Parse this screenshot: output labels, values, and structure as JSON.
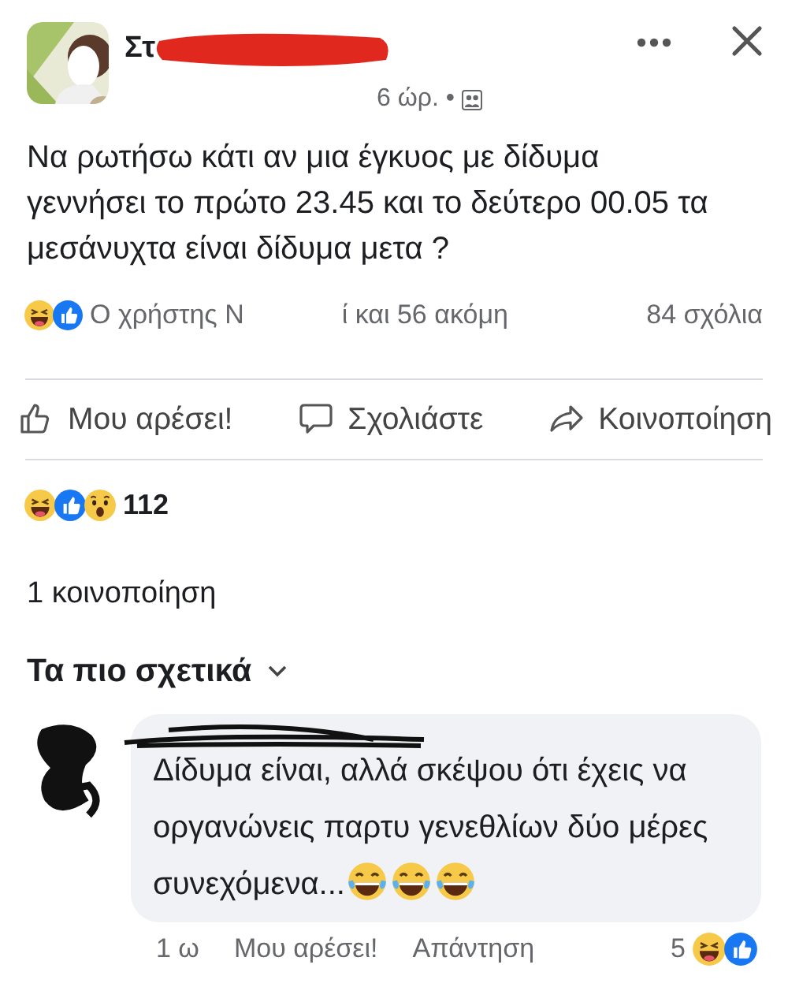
{
  "post": {
    "author": "Στ",
    "time": "6 ώρ. •",
    "text": "Να ρωτήσω κάτι αν μια έγκυος με δίδυμα γεννήσει το πρώτο 23.45 και το δεύτερο 00.05 τα μεσάνυχτα είναι δίδυμα μετα ?",
    "reactions": [
      {
        "kind": "haha"
      },
      {
        "kind": "like"
      }
    ],
    "likers_start": "Ο χρήστης Ν",
    "likers_end": "ί και 56 ακόμη",
    "comments_count": "84 σχόλια"
  },
  "actions": [
    {
      "kind": "like",
      "label": "Μου αρέσει!"
    },
    {
      "kind": "comment",
      "label": "Σχολιάστε"
    },
    {
      "kind": "share",
      "label": "Κοινοποίηση"
    }
  ],
  "reaction_summary": {
    "reactions": [
      {
        "kind": "haha"
      },
      {
        "kind": "like"
      },
      {
        "kind": "wow"
      }
    ],
    "count": "112"
  },
  "shares": "1 κοινοποίηση",
  "sort": {
    "label": "Τα πιο σχετικά"
  },
  "comments": [
    {
      "text": "Δίδυμα είναι, αλλά σκέψου ότι έχεις να οργανώνεις παρτυ γενεθλίων δύο μέρες συνεχόμενα...",
      "emojis": [
        {
          "kind": "tears"
        },
        {
          "kind": "tears"
        },
        {
          "kind": "tears"
        }
      ],
      "time": "1 ω",
      "like": "Μου αρέσει!",
      "reply": "Απάντηση",
      "reaction_count": "5",
      "reactions": [
        {
          "kind": "haha"
        },
        {
          "kind": "like"
        }
      ]
    }
  ]
}
